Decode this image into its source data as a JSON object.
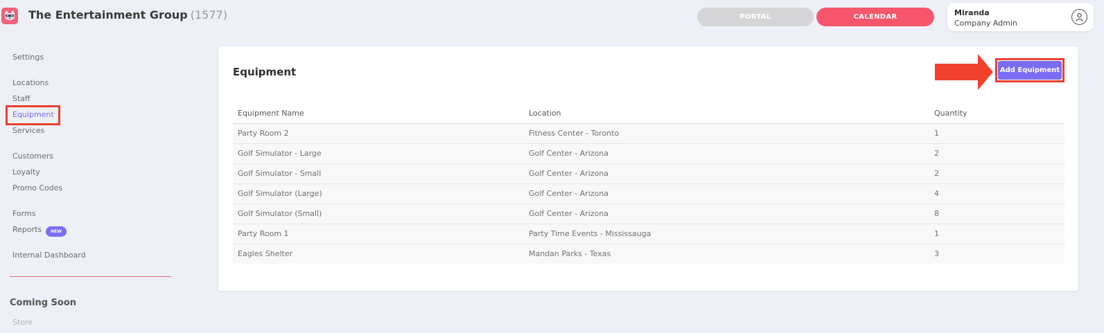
{
  "header": {
    "brand_name": "The Entertainment Group",
    "brand_count": "(1577)",
    "portal_label": "PORTAL",
    "calendar_label": "CALENDAR",
    "user_name": "Miranda",
    "user_role": "Company Admin",
    "logo_icon": "raccoon-logo-icon",
    "avatar_icon": "user-circle-icon"
  },
  "sidebar": {
    "items": [
      {
        "label": "Settings"
      },
      {
        "label": "Locations"
      },
      {
        "label": "Staff"
      },
      {
        "label": "Equipment",
        "active": true
      },
      {
        "label": "Services"
      },
      {
        "label": "Customers"
      },
      {
        "label": "Loyalty"
      },
      {
        "label": "Promo Codes"
      },
      {
        "label": "Forms"
      },
      {
        "label": "Reports"
      },
      {
        "label": "Internal Dashboard"
      }
    ],
    "new_badge": "NEW",
    "coming_soon_heading": "Coming Soon",
    "coming_soon_items": [
      {
        "label": "Store"
      }
    ]
  },
  "main": {
    "title": "Equipment",
    "add_button_label": "Add Equipment",
    "table": {
      "columns": [
        "Equipment Name",
        "Location",
        "Quantity"
      ],
      "rows": [
        [
          "Party Room 2",
          "Fitness Center - Toronto",
          "1"
        ],
        [
          "Golf Simulator - Large",
          "Golf Center - Arizona",
          "2"
        ],
        [
          "Golf Simulator - Small",
          "Golf Center - Arizona",
          "2"
        ],
        [
          "Golf Simulator (Large)",
          "Golf Center - Arizona",
          "4"
        ],
        [
          "Golf Simulator (Small)",
          "Golf Center - Arizona",
          "8"
        ],
        [
          "Party Room 1",
          "Party Time Events - Mississauga",
          "1"
        ],
        [
          "Eagles Shelter",
          "Mandan Parks - Texas",
          "3"
        ]
      ]
    }
  },
  "colors": {
    "accent_purple": "#7b6cf6",
    "calendar_red": "#f5566b",
    "highlight_red": "#e8402e",
    "background": "#eef0f8"
  }
}
